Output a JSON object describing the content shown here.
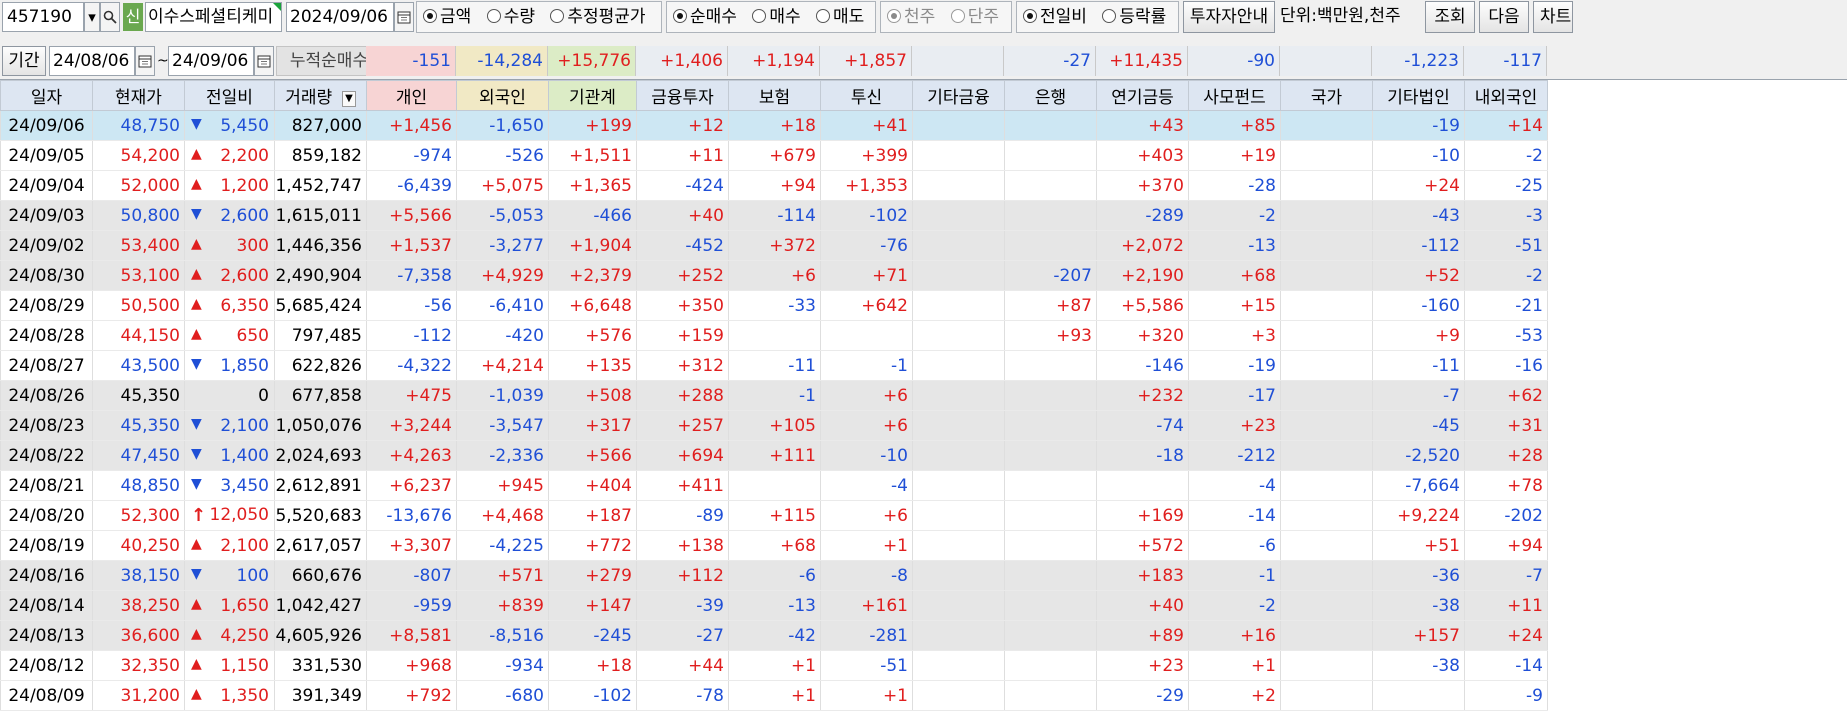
{
  "toolbar": {
    "code": "457190",
    "badge": "신",
    "name": "이수스페셜티케미",
    "date": "2024/09/06",
    "opt_group1": [
      {
        "label": "금액",
        "on": true
      },
      {
        "label": "수량",
        "on": false
      },
      {
        "label": "추정평균가",
        "on": false
      }
    ],
    "opt_group2": [
      {
        "label": "순매수",
        "on": true
      },
      {
        "label": "매수",
        "on": false
      },
      {
        "label": "매도",
        "on": false
      }
    ],
    "opt_group3": [
      {
        "label": "천주",
        "on": true
      },
      {
        "label": "단주",
        "on": false
      }
    ],
    "opt_group4": [
      {
        "label": "전일비",
        "on": true
      },
      {
        "label": "등락률",
        "on": false
      }
    ],
    "investor_btn": "투자자안내",
    "unit": "단위:백만원,천주",
    "query_btn": "조회",
    "next_btn": "다음",
    "chart_btn": "차트"
  },
  "period": {
    "label": "기간",
    "start": "24/08/06",
    "tilde": "~",
    "end": "24/09/06",
    "cum_label": "누적순매수"
  },
  "cumulative": [
    "-151",
    "-14,284",
    "+15,776",
    "+1,406",
    "+1,194",
    "+1,857",
    "",
    "-27",
    "+11,435",
    "-90",
    "",
    "-1,223",
    "-117"
  ],
  "columns": [
    "일자",
    "현재가",
    "전일비",
    "거래량",
    "개인",
    "외국인",
    "기관계",
    "금융투자",
    "보험",
    "투신",
    "기타금융",
    "은행",
    "연기금등",
    "사모펀드",
    "국가",
    "기타법인",
    "내외국인"
  ],
  "colors": {
    "up": "#e01e1e",
    "down": "#1f4fd6",
    "header_bg": "#dde6f2",
    "selected_bg": "#cde7f3",
    "grey_bg": "#e6e6e6",
    "individual_bg": "#f7d4d4",
    "foreign_bg": "#f1e9c5",
    "inst_bg": "#dcecc6"
  },
  "rows": [
    {
      "date": "24/09/06",
      "price": "48,750",
      "arrow": "▼",
      "change": "5,450",
      "dir": "dn",
      "volume": "827,000",
      "vals": [
        "+1,456",
        "-1,650",
        "+199",
        "+12",
        "+18",
        "+41",
        "",
        "",
        "+43",
        "+85",
        "",
        "-19",
        "+14"
      ]
    },
    {
      "date": "24/09/05",
      "price": "54,200",
      "arrow": "▲",
      "change": "2,200",
      "dir": "up",
      "volume": "859,182",
      "vals": [
        "-974",
        "-526",
        "+1,511",
        "+11",
        "+679",
        "+399",
        "",
        "",
        "+403",
        "+19",
        "",
        "-10",
        "-2"
      ]
    },
    {
      "date": "24/09/04",
      "price": "52,000",
      "arrow": "▲",
      "change": "1,200",
      "dir": "up",
      "volume": "1,452,747",
      "vals": [
        "-6,439",
        "+5,075",
        "+1,365",
        "-424",
        "+94",
        "+1,353",
        "",
        "",
        "+370",
        "-28",
        "",
        "+24",
        "-25"
      ]
    },
    {
      "date": "24/09/03",
      "price": "50,800",
      "arrow": "▼",
      "change": "2,600",
      "dir": "dn",
      "volume": "1,615,011",
      "vals": [
        "+5,566",
        "-5,053",
        "-466",
        "+40",
        "-114",
        "-102",
        "",
        "",
        "-289",
        "-2",
        "",
        "-43",
        "-3"
      ]
    },
    {
      "date": "24/09/02",
      "price": "53,400",
      "arrow": "▲",
      "change": "300",
      "dir": "up",
      "volume": "1,446,356",
      "vals": [
        "+1,537",
        "-3,277",
        "+1,904",
        "-452",
        "+372",
        "-76",
        "",
        "",
        "+2,072",
        "-13",
        "",
        "-112",
        "-51"
      ]
    },
    {
      "date": "24/08/30",
      "price": "53,100",
      "arrow": "▲",
      "change": "2,600",
      "dir": "up",
      "volume": "2,490,904",
      "vals": [
        "-7,358",
        "+4,929",
        "+2,379",
        "+252",
        "+6",
        "+71",
        "",
        "-207",
        "+2,190",
        "+68",
        "",
        "+52",
        "-2"
      ]
    },
    {
      "date": "24/08/29",
      "price": "50,500",
      "arrow": "▲",
      "change": "6,350",
      "dir": "up",
      "volume": "5,685,424",
      "vals": [
        "-56",
        "-6,410",
        "+6,648",
        "+350",
        "-33",
        "+642",
        "",
        "+87",
        "+5,586",
        "+15",
        "",
        "-160",
        "-21"
      ]
    },
    {
      "date": "24/08/28",
      "price": "44,150",
      "arrow": "▲",
      "change": "650",
      "dir": "up",
      "volume": "797,485",
      "vals": [
        "-112",
        "-420",
        "+576",
        "+159",
        "",
        "",
        "",
        "+93",
        "+320",
        "+3",
        "",
        "+9",
        "-53"
      ]
    },
    {
      "date": "24/08/27",
      "price": "43,500",
      "arrow": "▼",
      "change": "1,850",
      "dir": "dn",
      "volume": "622,826",
      "vals": [
        "-4,322",
        "+4,214",
        "+135",
        "+312",
        "-11",
        "-1",
        "",
        "",
        "-146",
        "-19",
        "",
        "-11",
        "-16"
      ]
    },
    {
      "date": "24/08/26",
      "price": "45,350",
      "arrow": "",
      "change": "0",
      "dir": "nu",
      "volume": "677,858",
      "vals": [
        "+475",
        "-1,039",
        "+508",
        "+288",
        "-1",
        "+6",
        "",
        "",
        "+232",
        "-17",
        "",
        "-7",
        "+62"
      ]
    },
    {
      "date": "24/08/23",
      "price": "45,350",
      "arrow": "▼",
      "change": "2,100",
      "dir": "dn",
      "volume": "1,050,076",
      "vals": [
        "+3,244",
        "-3,547",
        "+317",
        "+257",
        "+105",
        "+6",
        "",
        "",
        "-74",
        "+23",
        "",
        "-45",
        "+31"
      ]
    },
    {
      "date": "24/08/22",
      "price": "47,450",
      "arrow": "▼",
      "change": "1,400",
      "dir": "dn",
      "volume": "2,024,693",
      "vals": [
        "+4,263",
        "-2,336",
        "+566",
        "+694",
        "+111",
        "-10",
        "",
        "",
        "-18",
        "-212",
        "",
        "-2,520",
        "+28"
      ]
    },
    {
      "date": "24/08/21",
      "price": "48,850",
      "arrow": "▼",
      "change": "3,450",
      "dir": "dn",
      "volume": "2,612,891",
      "vals": [
        "+6,237",
        "+945",
        "+404",
        "+411",
        "",
        "-4",
        "",
        "",
        "",
        "-4",
        "",
        "-7,664",
        "+78"
      ]
    },
    {
      "date": "24/08/20",
      "price": "52,300",
      "arrow": "↑",
      "change": "12,050",
      "dir": "up",
      "volume": "5,520,683",
      "vals": [
        "-13,676",
        "+4,468",
        "+187",
        "-89",
        "+115",
        "+6",
        "",
        "",
        "+169",
        "-14",
        "",
        "+9,224",
        "-202"
      ]
    },
    {
      "date": "24/08/19",
      "price": "40,250",
      "arrow": "▲",
      "change": "2,100",
      "dir": "up",
      "volume": "2,617,057",
      "vals": [
        "+3,307",
        "-4,225",
        "+772",
        "+138",
        "+68",
        "+1",
        "",
        "",
        "+572",
        "-6",
        "",
        "+51",
        "+94"
      ]
    },
    {
      "date": "24/08/16",
      "price": "38,150",
      "arrow": "▼",
      "change": "100",
      "dir": "dn",
      "volume": "660,676",
      "vals": [
        "-807",
        "+571",
        "+279",
        "+112",
        "-6",
        "-8",
        "",
        "",
        "+183",
        "-1",
        "",
        "-36",
        "-7"
      ]
    },
    {
      "date": "24/08/14",
      "price": "38,250",
      "arrow": "▲",
      "change": "1,650",
      "dir": "up",
      "volume": "1,042,427",
      "vals": [
        "-959",
        "+839",
        "+147",
        "-39",
        "-13",
        "+161",
        "",
        "",
        "+40",
        "-2",
        "",
        "-38",
        "+11"
      ]
    },
    {
      "date": "24/08/13",
      "price": "36,600",
      "arrow": "▲",
      "change": "4,250",
      "dir": "up",
      "volume": "4,605,926",
      "vals": [
        "+8,581",
        "-8,516",
        "-245",
        "-27",
        "-42",
        "-281",
        "",
        "",
        "+89",
        "+16",
        "",
        "+157",
        "+24"
      ]
    },
    {
      "date": "24/08/12",
      "price": "32,350",
      "arrow": "▲",
      "change": "1,150",
      "dir": "up",
      "volume": "331,530",
      "vals": [
        "+968",
        "-934",
        "+18",
        "+44",
        "+1",
        "-51",
        "",
        "",
        "+23",
        "+1",
        "",
        "-38",
        "-14"
      ]
    },
    {
      "date": "24/08/09",
      "price": "31,200",
      "arrow": "▲",
      "change": "1,350",
      "dir": "up",
      "volume": "391,349",
      "vals": [
        "+792",
        "-680",
        "-102",
        "-78",
        "+1",
        "+1",
        "",
        "",
        "-29",
        "+2",
        "",
        "",
        "-9"
      ]
    }
  ]
}
